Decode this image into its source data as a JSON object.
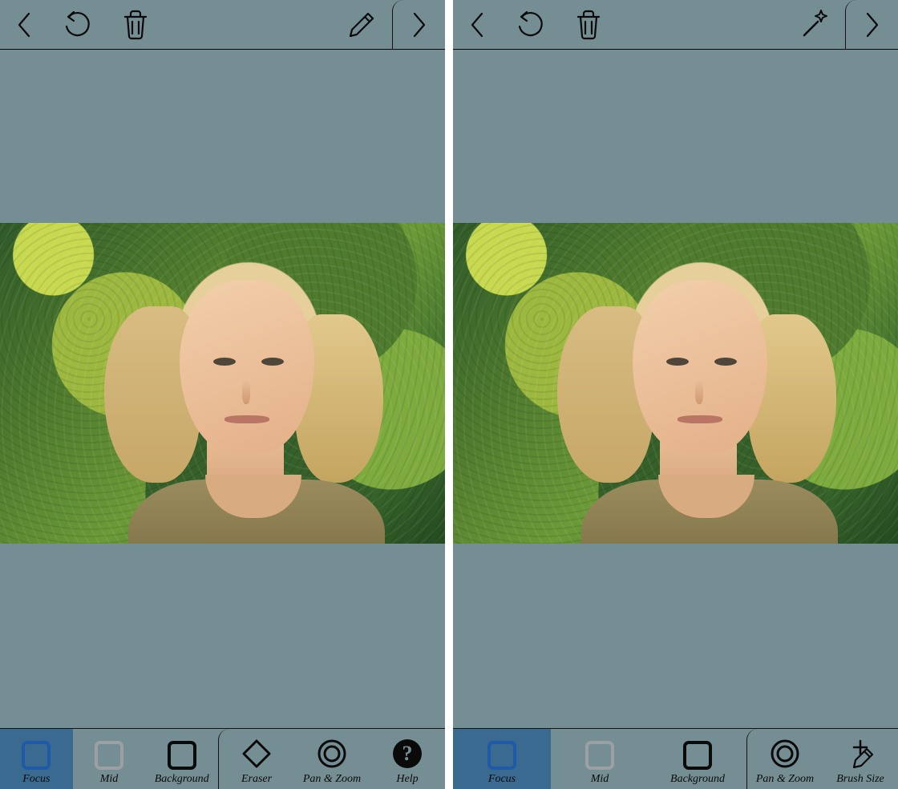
{
  "left": {
    "top": {
      "action_icon": "pencil-icon"
    },
    "layers": [
      {
        "id": "focus",
        "label": "Focus",
        "style": "blue",
        "selected": true
      },
      {
        "id": "mid",
        "label": "Mid",
        "style": "grey",
        "selected": false
      },
      {
        "id": "background",
        "label": "Background",
        "style": "black",
        "selected": false
      }
    ],
    "tools": [
      {
        "id": "eraser",
        "label": "Eraser",
        "icon": "eraser-icon"
      },
      {
        "id": "panzoom",
        "label": "Pan & Zoom",
        "icon": "target-icon"
      },
      {
        "id": "help",
        "label": "Help",
        "icon": "help-icon"
      }
    ]
  },
  "right": {
    "top": {
      "action_icon": "wand-icon"
    },
    "layers": [
      {
        "id": "focus",
        "label": "Focus",
        "style": "blue",
        "selected": true
      },
      {
        "id": "mid",
        "label": "Mid",
        "style": "grey",
        "selected": false
      },
      {
        "id": "background",
        "label": "Background",
        "style": "black",
        "selected": false
      }
    ],
    "tools": [
      {
        "id": "panzoom",
        "label": "Pan & Zoom",
        "icon": "target-icon"
      },
      {
        "id": "brushsize",
        "label": "Brush Size",
        "icon": "brushsize-icon"
      }
    ]
  }
}
